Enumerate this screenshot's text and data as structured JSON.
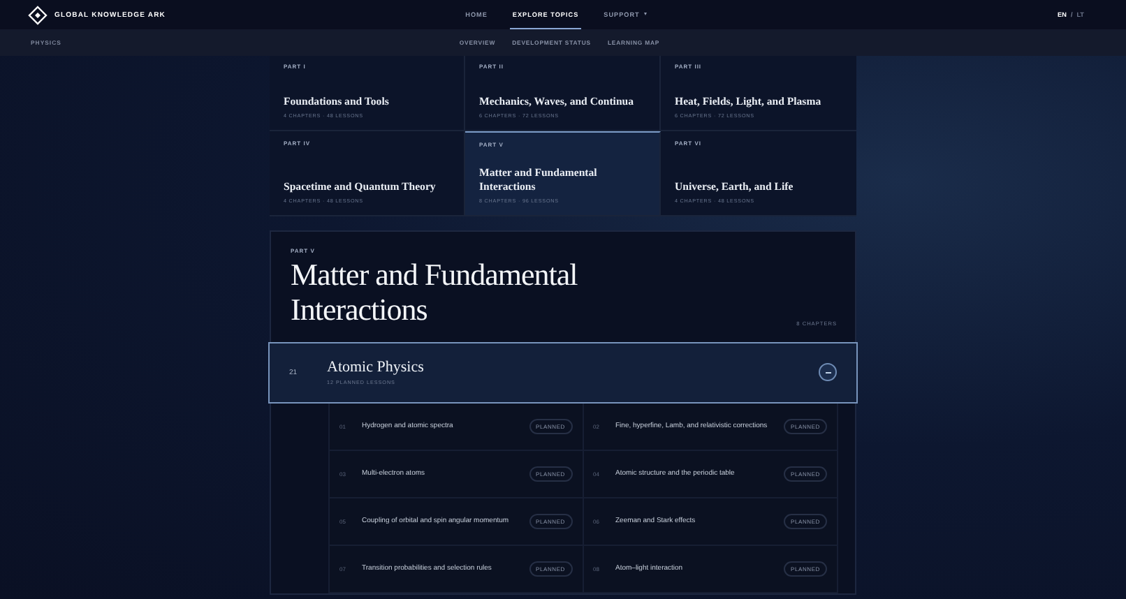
{
  "header": {
    "brand": "GLOBAL KNOWLEDGE ARK",
    "nav": [
      {
        "label": "HOME",
        "selected": false
      },
      {
        "label": "EXPLORE TOPICS",
        "selected": true
      },
      {
        "label": "SUPPORT",
        "selected": false,
        "dropdown": true
      }
    ],
    "languages": [
      {
        "label": "EN",
        "selected": true
      },
      {
        "label": "LT",
        "selected": false
      }
    ],
    "separator": "/"
  },
  "subnav": {
    "section": "PHYSICS",
    "links": [
      {
        "label": "OVERVIEW"
      },
      {
        "label": "DEVELOPMENT STATUS"
      },
      {
        "label": "LEARNING MAP"
      }
    ]
  },
  "parts": [
    {
      "label": "PART I",
      "title": "Foundations and Tools",
      "meta": "4 CHAPTERS · 48 LESSONS",
      "selected": false
    },
    {
      "label": "PART II",
      "title": "Mechanics, Waves, and Continua",
      "meta": "6 CHAPTERS · 72 LESSONS",
      "selected": false
    },
    {
      "label": "PART III",
      "title": "Heat, Fields, Light, and Plasma",
      "meta": "6 CHAPTERS · 72 LESSONS",
      "selected": false
    },
    {
      "label": "PART IV",
      "title": "Spacetime and Quantum Theory",
      "meta": "4 CHAPTERS · 48 LESSONS",
      "selected": false
    },
    {
      "label": "PART V",
      "title": "Matter and Fundamental Interactions",
      "meta": "8 CHAPTERS · 96 LESSONS",
      "selected": true
    },
    {
      "label": "PART VI",
      "title": "Universe, Earth, and Life",
      "meta": "4 CHAPTERS · 48 LESSONS",
      "selected": false
    }
  ],
  "detail": {
    "label": "PART V",
    "title": "Matter and Fundamental Interactions",
    "count": "8 CHAPTERS"
  },
  "chapter": {
    "number": "21",
    "title": "Atomic Physics",
    "meta": "12 PLANNED LESSONS",
    "expanded": true
  },
  "lessons": [
    {
      "number": "01",
      "title": "Hydrogen and atomic spectra",
      "status": "PLANNED"
    },
    {
      "number": "02",
      "title": "Fine, hyperfine, Lamb, and relativistic corrections",
      "status": "PLANNED"
    },
    {
      "number": "03",
      "title": "Multi-electron atoms",
      "status": "PLANNED"
    },
    {
      "number": "04",
      "title": "Atomic structure and the periodic table",
      "status": "PLANNED"
    },
    {
      "number": "05",
      "title": "Coupling of orbital and spin angular momentum",
      "status": "PLANNED"
    },
    {
      "number": "06",
      "title": "Zeeman and Stark effects",
      "status": "PLANNED"
    },
    {
      "number": "07",
      "title": "Transition probabilities and selection rules",
      "status": "PLANNED"
    },
    {
      "number": "08",
      "title": "Atom–light interaction",
      "status": "PLANNED"
    }
  ]
}
